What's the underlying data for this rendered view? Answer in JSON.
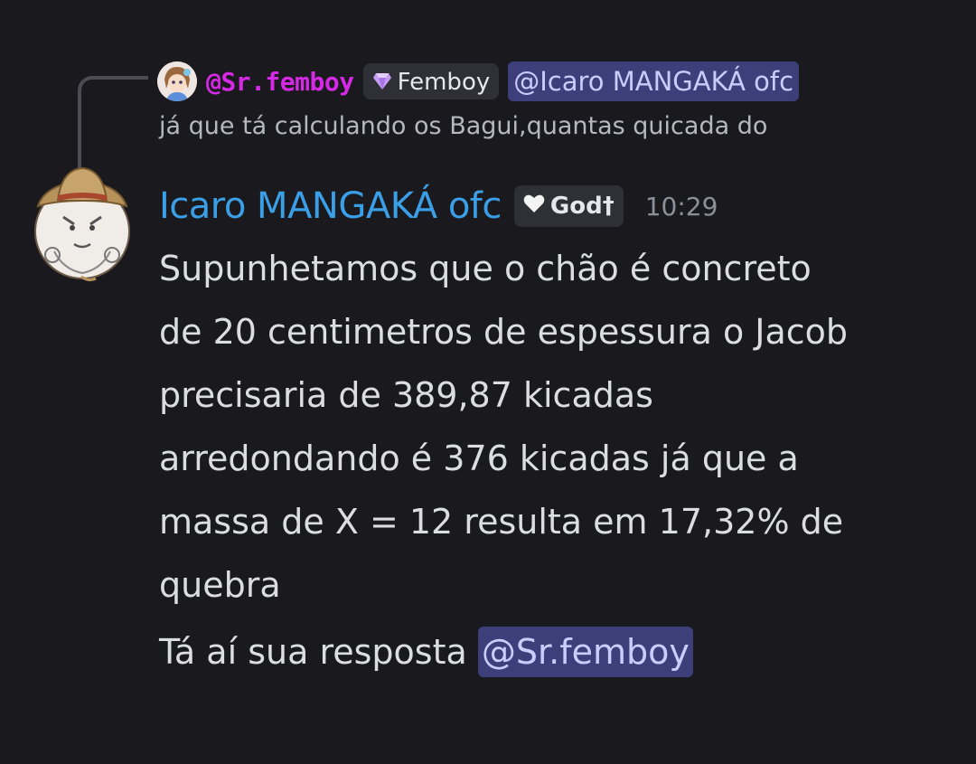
{
  "reply": {
    "author": "@Sr.femboy",
    "tag_icon": "gem-icon",
    "tag_label": "Femboy",
    "mention": "@Icaro MANGAKÁ ofc",
    "text": "já que tá calculando os Bagui,quantas quicada do",
    "name_color": "#d629e6"
  },
  "message": {
    "author": "Icaro MANGAKÁ ofc",
    "author_color": "#3a9fe6",
    "badge_icon": "heart-icon",
    "badge_label": "God†",
    "timestamp": "10:29",
    "lines": [
      "Supunhetamos que o chão é concreto",
      "de 20 centimetros de espessura o Jacob",
      "precisaria de 389,87 kicadas",
      "arredondando é 376 kicadas já que a",
      "massa de X = 12 resulta em 17,32% de",
      "quebra"
    ],
    "answer_prefix": "Tá aí sua resposta ",
    "answer_mention": "@Sr.femboy"
  },
  "colors": {
    "background": "#1a1a1e",
    "mention_bg": "#3c3f7a",
    "mention_text": "#c9cdfb",
    "pill_bg": "#2f3036"
  }
}
